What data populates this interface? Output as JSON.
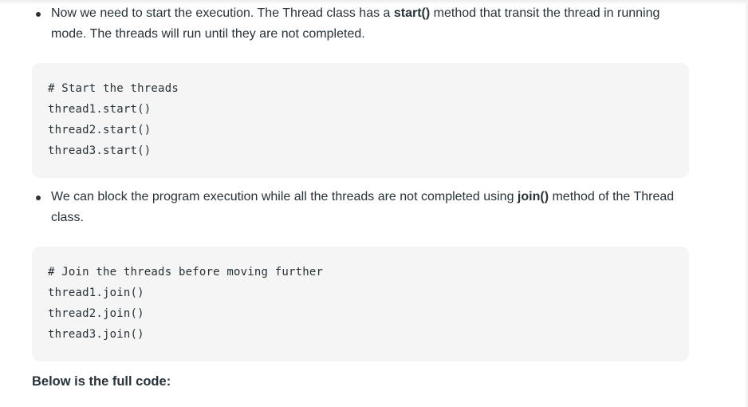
{
  "bullet1": {
    "text_before": "Now we need to start the execution. The Thread class has a ",
    "bold": "start()",
    "text_after": " method that transit the thread in running mode. The threads will run until they are not completed."
  },
  "code1": {
    "lines": [
      "# Start the threads",
      "thread1.start()",
      "thread2.start()",
      "thread3.start()"
    ]
  },
  "bullet2": {
    "text_before": "We can block the program execution while all the threads are not completed using ",
    "bold": "join()",
    "text_after": " method of the Thread class."
  },
  "code2": {
    "lines": [
      "# Join the threads before moving further",
      "thread1.join()",
      "thread2.join()",
      "thread3.join()"
    ]
  },
  "summary": "Below is the full code:"
}
